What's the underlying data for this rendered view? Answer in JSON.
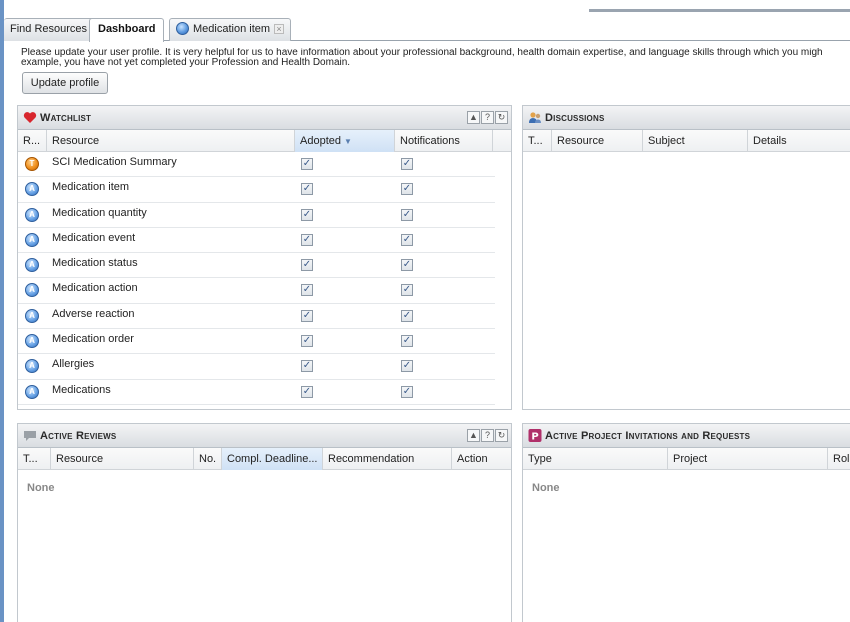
{
  "tabs": {
    "find_resources": "Find Resources",
    "dashboard": "Dashboard",
    "medication_item": "Medication item",
    "close_glyph": "×"
  },
  "notice": {
    "line1": "Please update your user profile. It is very helpful for us to have information about your professional background, health domain expertise, and language skills through which you migh",
    "line2": "example, you have not yet completed your Profession and Health Domain.",
    "button_label": "Update profile"
  },
  "watchlist": {
    "title": "Watchlist",
    "tool_up": "▲",
    "tool_help": "?",
    "tool_refresh": "↻",
    "columns": {
      "r": "R...",
      "resource": "Resource",
      "adopted": "Adopted",
      "notifications": "Notifications"
    },
    "sort_indicator": "▼",
    "rows": [
      {
        "resource": "SCI Medication Summary",
        "icon": "orange-template-icon",
        "icon_letter": "T",
        "adopted": true,
        "notifications": true
      },
      {
        "resource": "Medication item",
        "icon": "globe-archetype-icon",
        "icon_letter": "A",
        "adopted": true,
        "notifications": true
      },
      {
        "resource": "Medication quantity",
        "icon": "globe-archetype-icon",
        "icon_letter": "A",
        "adopted": true,
        "notifications": true
      },
      {
        "resource": "Medication event",
        "icon": "globe-archetype-icon",
        "icon_letter": "A",
        "adopted": true,
        "notifications": true
      },
      {
        "resource": "Medication status",
        "icon": "globe-archetype-icon",
        "icon_letter": "A",
        "adopted": true,
        "notifications": true
      },
      {
        "resource": "Medication action",
        "icon": "globe-archetype-icon",
        "icon_letter": "A",
        "adopted": true,
        "notifications": true
      },
      {
        "resource": "Adverse reaction",
        "icon": "globe-archetype-icon",
        "icon_letter": "A",
        "adopted": true,
        "notifications": true
      },
      {
        "resource": "Medication order",
        "icon": "globe-archetype-icon",
        "icon_letter": "A",
        "adopted": true,
        "notifications": true
      },
      {
        "resource": "Allergies",
        "icon": "globe-archetype-icon",
        "icon_letter": "A",
        "adopted": true,
        "notifications": true
      },
      {
        "resource": "Medications",
        "icon": "globe-archetype-icon",
        "icon_letter": "A",
        "adopted": true,
        "notifications": true
      }
    ],
    "check_glyph": "✓"
  },
  "discussions": {
    "title": "Discussions",
    "columns": {
      "t": "T...",
      "resource": "Resource",
      "subject": "Subject",
      "details": "Details"
    }
  },
  "reviews": {
    "title": "Active Reviews",
    "tool_up": "▲",
    "tool_help": "?",
    "tool_refresh": "↻",
    "columns": {
      "t": "T...",
      "resource": "Resource",
      "no": "No.",
      "deadline": "Compl. Deadline...",
      "recommendation": "Recommendation",
      "action": "Action"
    },
    "empty_text": "None"
  },
  "invitations": {
    "title": "Active Project Invitations and Requests",
    "icon_letter": "P",
    "columns": {
      "type": "Type",
      "project": "Project",
      "role": "Rol"
    },
    "empty_text": "None"
  },
  "colors": {
    "accent_blue": "#6a93c5",
    "heart_red": "#d8262d",
    "project_badge": "#b0306a",
    "template_orange": "#f0901e"
  }
}
